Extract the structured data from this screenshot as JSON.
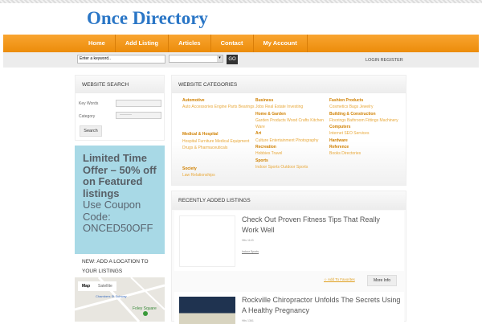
{
  "site": {
    "logo": "Once Directory"
  },
  "nav": [
    "Home",
    "Add Listing",
    "Articles",
    "Contact",
    "My Account"
  ],
  "search_bar": {
    "placeholder": "Enter a keyword..",
    "go": "GO",
    "login": "LOGIN REGISTER"
  },
  "website_search": {
    "title": "WEBSITE SEARCH",
    "keywords_label": "Key Words",
    "category_label": "Category",
    "category_value": "———",
    "button": "Search"
  },
  "promo": {
    "bold": "Limited Time Offer – 50% off on Featured listings",
    "text": "Use Coupon Code: ONCED50OFF"
  },
  "location": {
    "title": "NEW: ADD A LOCATION TO YOUR LISTINGS",
    "map_tab": "Map",
    "satellite_tab": "Satellite",
    "place1": "Chambers St Subway",
    "place2": "Foley Square"
  },
  "categories": {
    "title": "WEBSITE CATEGORIES",
    "columns": [
      [
        {
          "name": "Automotive",
          "items": "Auto Accessories Engine Parts Bearings"
        },
        {
          "name": "Medical & Hospital",
          "items": "Hospital Furniture Medical Equipment Drugs & Pharmaceuticals"
        },
        {
          "name": "Society",
          "items": "Law Relationships"
        }
      ],
      [
        {
          "name": "Business",
          "items": "Jobs Real Estate Investing"
        },
        {
          "name": "Home & Garden",
          "items": "Garden Products Wood Crafts Kitchen Ware"
        },
        {
          "name": "Art",
          "items": "Culture Entertainment Photography"
        },
        {
          "name": "Recreation",
          "items": "Hobbies Travel"
        },
        {
          "name": "Sports",
          "items": "Indoor Sports Outdoor Sports"
        }
      ],
      [
        {
          "name": "Fashion Products",
          "items": "Cosmetics Bags Jewelry"
        },
        {
          "name": "Building & Construction",
          "items": "Floorings Bathroom Fittings Machinery"
        },
        {
          "name": "Computers",
          "items": "Internet SEO Services"
        },
        {
          "name": "Hardware",
          "items": ""
        },
        {
          "name": "Reference",
          "items": "Books Directories"
        }
      ]
    ]
  },
  "listings": {
    "title": "RECENTLY ADDED LISTINGS",
    "items": [
      {
        "title": "Check Out Proven Fitness Tips That Really Work Well",
        "meta": "Hits 1143",
        "category": "Indoor Sports",
        "fav": "Add To Favorites",
        "more": "More Info"
      },
      {
        "title": "Rockville Chiropractor Unfolds The Secrets Using A Healthy Pregnancy",
        "meta": "Hits 1361"
      }
    ]
  }
}
